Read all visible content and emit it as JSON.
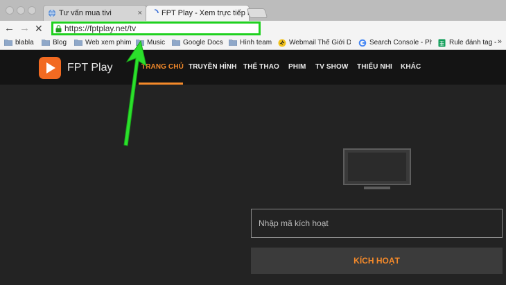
{
  "browser": {
    "tabs": [
      {
        "title": "Tư vấn mua tivi",
        "favicon": "globe-icon"
      },
      {
        "title": "FPT Play - Xem trực tiếp N",
        "favicon": "loading-spinner-icon"
      }
    ],
    "tab_close_glyph": "×",
    "omnibox": {
      "url": "https://fptplay.net/tv"
    },
    "bookmarks": [
      {
        "label": "blabla",
        "icon": "folder-icon"
      },
      {
        "label": "Blog",
        "icon": "folder-icon"
      },
      {
        "label": "Web xem phim",
        "icon": "folder-icon"
      },
      {
        "label": "Music",
        "icon": "folder-icon"
      },
      {
        "label": "Google Docs",
        "icon": "folder-icon"
      },
      {
        "label": "Hình team",
        "icon": "folder-icon"
      },
      {
        "label": "Webmail Thế Giới Di",
        "icon": "runner-icon"
      },
      {
        "label": "Search Console - Phi",
        "icon": "google-icon"
      },
      {
        "label": "Rule đánh tag - đánh",
        "icon": "sheets-icon"
      }
    ],
    "more_bookmarks": "»"
  },
  "site": {
    "logo_text": "FPT Play",
    "nav": [
      "TRANG CHỦ",
      "TRUYỀN HÌNH",
      "THỂ THAO",
      "PHIM",
      "TV SHOW",
      "THIẾU NHI",
      "KHÁC"
    ],
    "activation": {
      "placeholder": "Nhập mã kích hoạt",
      "button_label": "KÍCH HOẠT"
    }
  },
  "colors": {
    "accent": "#f58a2a",
    "logo": "#f26a21",
    "highlight": "#1fd11f"
  }
}
